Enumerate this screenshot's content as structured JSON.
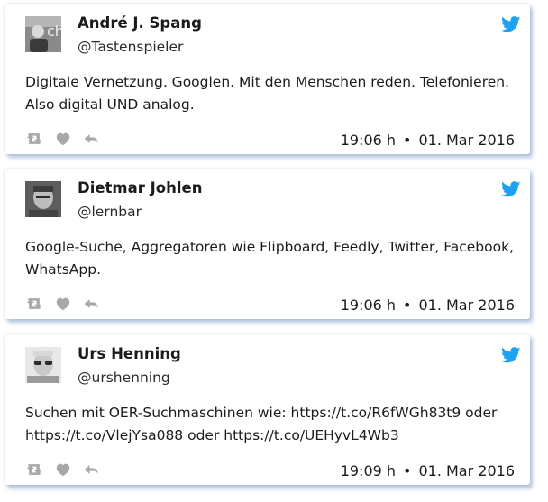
{
  "colors": {
    "accent": "#1da1f2",
    "icon_gray": "#a8a8a8",
    "card_shadow": "#7896c8"
  },
  "tweets": [
    {
      "name": "André J. Spang",
      "handle": "@Tastenspieler",
      "text": "Digitale Vernetzung. Googlen. Mit den Menschen reden. Telefonieren. Also digital UND analog.",
      "time": "19:06 h",
      "separator": "•",
      "date": "01. Mar 2016",
      "avatar_icon": "avatar-photo",
      "brand_icon": "twitter-bird-icon"
    },
    {
      "name": "Dietmar Johlen",
      "handle": "@lernbar",
      "text": "Google-Suche, Aggregatoren wie Flipboard, Feedly, Twitter, Facebook, WhatsApp.",
      "time": "19:06 h",
      "separator": "•",
      "date": "01. Mar 2016",
      "avatar_icon": "avatar-photo",
      "brand_icon": "twitter-bird-icon"
    },
    {
      "name": "Urs Henning",
      "handle": "@urshenning",
      "text": "Suchen mit OER-Suchmaschinen wie: https://t.co/R6fWGh83t9 oder https://t.co/VlejYsa088 oder https://t.co/UEHyvL4Wb3",
      "time": "19:09 h",
      "separator": "•",
      "date": "01. Mar 2016",
      "avatar_icon": "avatar-photo",
      "brand_icon": "twitter-bird-icon"
    }
  ],
  "action_icons": [
    "retweet-icon",
    "like-icon",
    "reply-icon"
  ]
}
